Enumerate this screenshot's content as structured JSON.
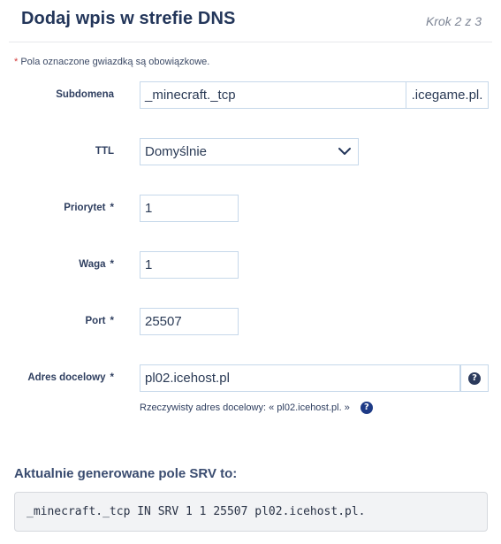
{
  "header": {
    "title": "Dodaj wpis w strefie DNS",
    "step": "Krok 2 z 3"
  },
  "required_note": {
    "star": "*",
    "text": "Pola oznaczone gwiazdką są obowiązkowe."
  },
  "form": {
    "subdomain": {
      "label": "Subdomena",
      "value": "_minecraft._tcp",
      "suffix": ".icegame.pl."
    },
    "ttl": {
      "label": "TTL",
      "selected": "Domyślnie"
    },
    "priority": {
      "label": "Priorytet",
      "required": "*",
      "value": "1"
    },
    "weight": {
      "label": "Waga",
      "required": "*",
      "value": "1"
    },
    "port": {
      "label": "Port",
      "required": "*",
      "value": "25507"
    },
    "target": {
      "label": "Adres docelowy",
      "required": "*",
      "value": "pl02.icehost.pl",
      "hint": "Rzeczywisty adres docelowy: « pl02.icehost.pl. »",
      "help_glyph": "?"
    }
  },
  "srv": {
    "heading": "Aktualnie generowane pole SRV to:",
    "record": "_minecraft._tcp IN SRV 1 1 25507 pl02.icehost.pl."
  },
  "icons": {
    "help": "question-circle-icon",
    "dropdown": "chevron-down-icon"
  },
  "colors": {
    "title": "#23365a",
    "field_border": "#c6d8ea",
    "required_star": "#d23b3b",
    "help_icon": "#1d3a86"
  }
}
